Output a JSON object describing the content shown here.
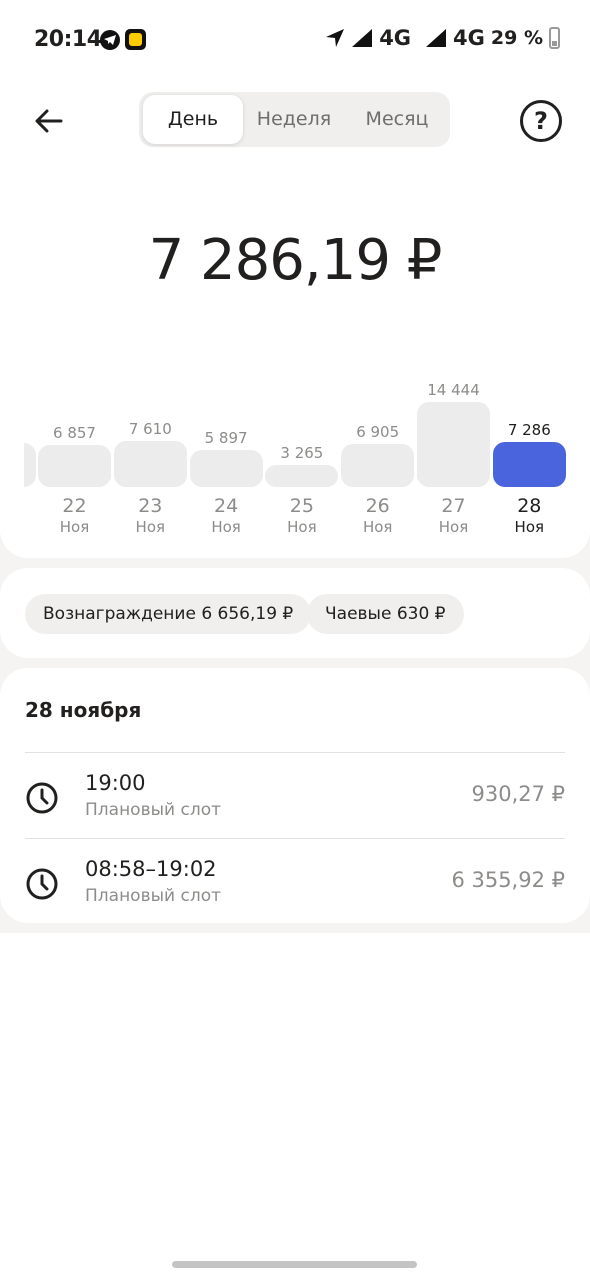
{
  "status_bar": {
    "time": "20:14",
    "net1": "4G",
    "net2": "4G",
    "battery": "29 %"
  },
  "header": {
    "tabs": [
      {
        "label": "День",
        "active": true
      },
      {
        "label": "Неделя",
        "active": false
      },
      {
        "label": "Месяц",
        "active": false
      }
    ],
    "help_icon": "question-circle-icon",
    "back_icon": "arrow-left-icon"
  },
  "total": "7 286,19 ₽",
  "chart_data": {
    "type": "bar",
    "categories": [
      "22",
      "23",
      "24",
      "25",
      "26",
      "27",
      "28"
    ],
    "month_labels": [
      "Ноя",
      "Ноя",
      "Ноя",
      "Ноя",
      "Ноя",
      "Ноя",
      "Ноя"
    ],
    "values": [
      6857,
      7610,
      5897,
      3265,
      6905,
      14444,
      7286
    ],
    "value_labels": [
      "6 857",
      "7 610",
      "5 897",
      "3 265",
      "6 905",
      "14 444",
      "7 286"
    ],
    "selected_index": 6,
    "colors": {
      "bar": "#ececec",
      "selected": "#4964dc"
    }
  },
  "chips": [
    {
      "label": "Вознаграждение 6 656,19 ₽"
    },
    {
      "label": "Чаевые 630 ₽"
    }
  ],
  "list": {
    "title": "28 ноября",
    "items": [
      {
        "time": "19:00",
        "subtitle": "Плановый слот",
        "amount": "930,27 ₽",
        "icon": "clock-icon"
      },
      {
        "time": "08:58–19:02",
        "subtitle": "Плановый слот",
        "amount": "6 355,92 ₽",
        "icon": "clock-icon"
      }
    ]
  }
}
